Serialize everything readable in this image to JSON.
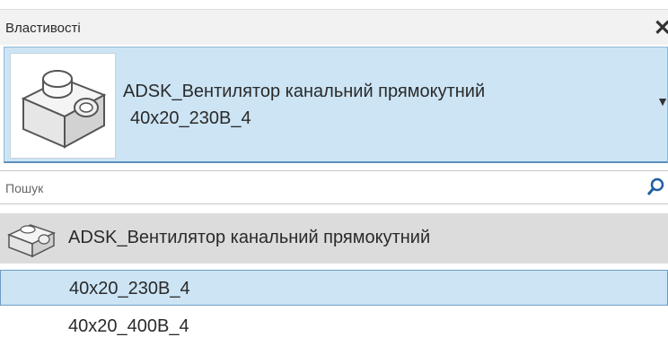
{
  "panel": {
    "title": "Властивості",
    "close_icon": "close-icon"
  },
  "type_selector": {
    "family_name": "ADSK_Вентилятор канальний прямокутний",
    "type_name": "40x20_230В_4",
    "dropdown_icon": "chevron-down-icon"
  },
  "search": {
    "label": "Пошук",
    "icon": "search-icon"
  },
  "list": {
    "family": {
      "label": "ADSK_Вентилятор канальний прямокутний"
    },
    "types": [
      {
        "label": "40x20_230В_4",
        "selected": true
      },
      {
        "label": "40x20_400В_4",
        "selected": false
      }
    ]
  },
  "colors": {
    "selection": "#cce4f4",
    "family_row": "#dcdcdc",
    "selection_border": "#6e9cc4"
  }
}
